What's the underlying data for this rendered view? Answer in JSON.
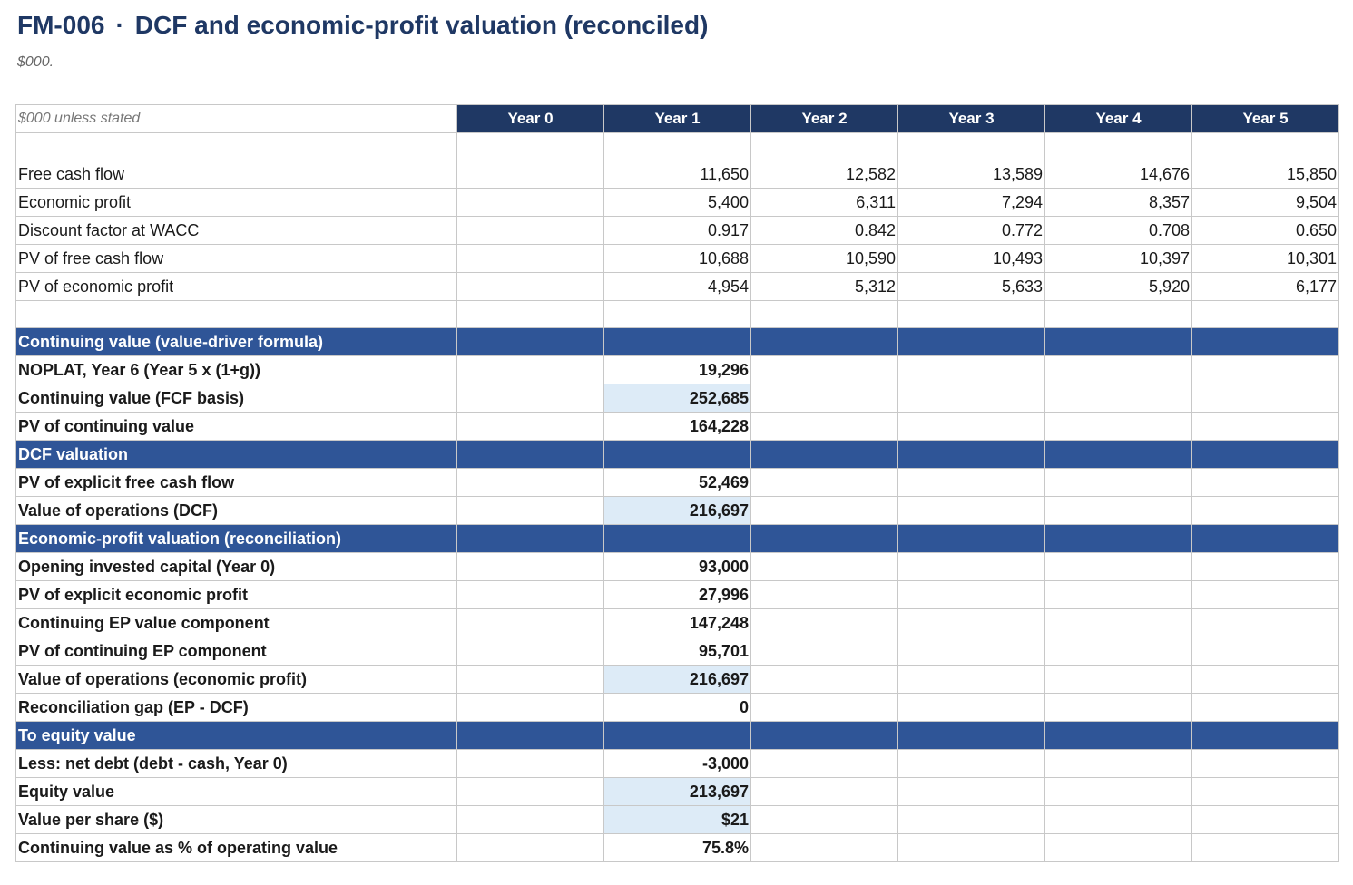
{
  "title": {
    "code": "FM-006",
    "separator": "·",
    "text": "DCF and economic-profit valuation (reconciled)"
  },
  "subtitle": "$000.",
  "table": {
    "units_label": "$000 unless stated",
    "years": [
      "Year 0",
      "Year 1",
      "Year 2",
      "Year 3",
      "Year 4",
      "Year 5"
    ],
    "schedule": [
      {
        "label": "Free cash flow",
        "values": [
          "",
          "11,650",
          "12,582",
          "13,589",
          "14,676",
          "15,850"
        ]
      },
      {
        "label": "Economic profit",
        "values": [
          "",
          "5,400",
          "6,311",
          "7,294",
          "8,357",
          "9,504"
        ]
      },
      {
        "label": "Discount factor at WACC",
        "values": [
          "",
          "0.917",
          "0.842",
          "0.772",
          "0.708",
          "0.650"
        ]
      },
      {
        "label": "PV of free cash flow",
        "values": [
          "",
          "10,688",
          "10,590",
          "10,493",
          "10,397",
          "10,301"
        ]
      },
      {
        "label": "PV of economic profit",
        "values": [
          "",
          "4,954",
          "5,312",
          "5,633",
          "5,920",
          "6,177"
        ]
      }
    ],
    "sections": [
      {
        "title": "Continuing value (value-driver formula)",
        "rows": [
          {
            "label": "NOPLAT, Year 6 (Year 5 x (1+g))",
            "value": "19,296",
            "highlight": false
          },
          {
            "label": "Continuing value (FCF basis)",
            "value": "252,685",
            "highlight": true
          },
          {
            "label": "PV of continuing value",
            "value": "164,228",
            "highlight": false
          }
        ]
      },
      {
        "title": "DCF valuation",
        "rows": [
          {
            "label": "PV of explicit free cash flow",
            "value": "52,469",
            "highlight": false
          },
          {
            "label": "Value of operations (DCF)",
            "value": "216,697",
            "highlight": true
          }
        ]
      },
      {
        "title": "Economic-profit valuation (reconciliation)",
        "rows": [
          {
            "label": "Opening invested capital (Year 0)",
            "value": "93,000",
            "highlight": false
          },
          {
            "label": "PV of explicit economic profit",
            "value": "27,996",
            "highlight": false
          },
          {
            "label": "Continuing EP value component",
            "value": "147,248",
            "highlight": false
          },
          {
            "label": "PV of continuing EP component",
            "value": "95,701",
            "highlight": false
          },
          {
            "label": "Value of operations (economic profit)",
            "value": "216,697",
            "highlight": true
          },
          {
            "label": "Reconciliation gap (EP - DCF)",
            "value": "0",
            "highlight": false
          }
        ]
      },
      {
        "title": "To equity value",
        "rows": [
          {
            "label": "Less: net debt (debt - cash, Year 0)",
            "value": "-3,000",
            "highlight": false
          },
          {
            "label": "Equity value",
            "value": "213,697",
            "highlight": true
          },
          {
            "label": "Value per share ($)",
            "value": "$21",
            "highlight": true
          },
          {
            "label": "Continuing value as % of operating value",
            "value": "75.8%",
            "highlight": false
          }
        ]
      }
    ]
  },
  "colors": {
    "title": "#1f3864",
    "header_fill": "#1f3864",
    "section_fill": "#2f5597",
    "highlight_fill": "#ddebf7",
    "gridline": "#c8c8c8"
  }
}
